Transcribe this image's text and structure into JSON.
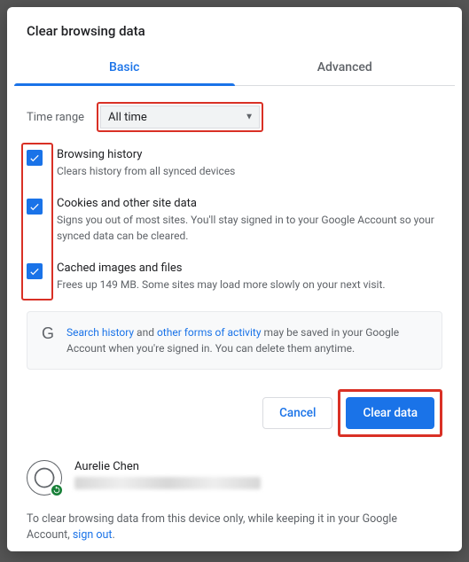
{
  "title": "Clear browsing data",
  "tabs": {
    "basic": "Basic",
    "advanced": "Advanced"
  },
  "time_range": {
    "label": "Time range",
    "value": "All time"
  },
  "options": {
    "history": {
      "title": "Browsing history",
      "desc": "Clears history from all synced devices",
      "checked": true
    },
    "cookies": {
      "title": "Cookies and other site data",
      "desc": "Signs you out of most sites. You'll stay signed in to your Google Account so your synced data can be cleared.",
      "checked": true
    },
    "cache": {
      "title": "Cached images and files",
      "desc": "Frees up 149 MB. Some sites may load more slowly on your next visit.",
      "checked": true
    }
  },
  "notice": {
    "link1": "Search history",
    "mid1": " and ",
    "link2": "other forms of activity",
    "rest": " may be saved in your Google Account when you're signed in. You can delete them anytime."
  },
  "buttons": {
    "cancel": "Cancel",
    "clear": "Clear data"
  },
  "profile": {
    "name": "Aurelie Chen"
  },
  "signout": {
    "text": "To clear browsing data from this device only, while keeping it in your Google Account, ",
    "link": "sign out",
    "period": "."
  }
}
